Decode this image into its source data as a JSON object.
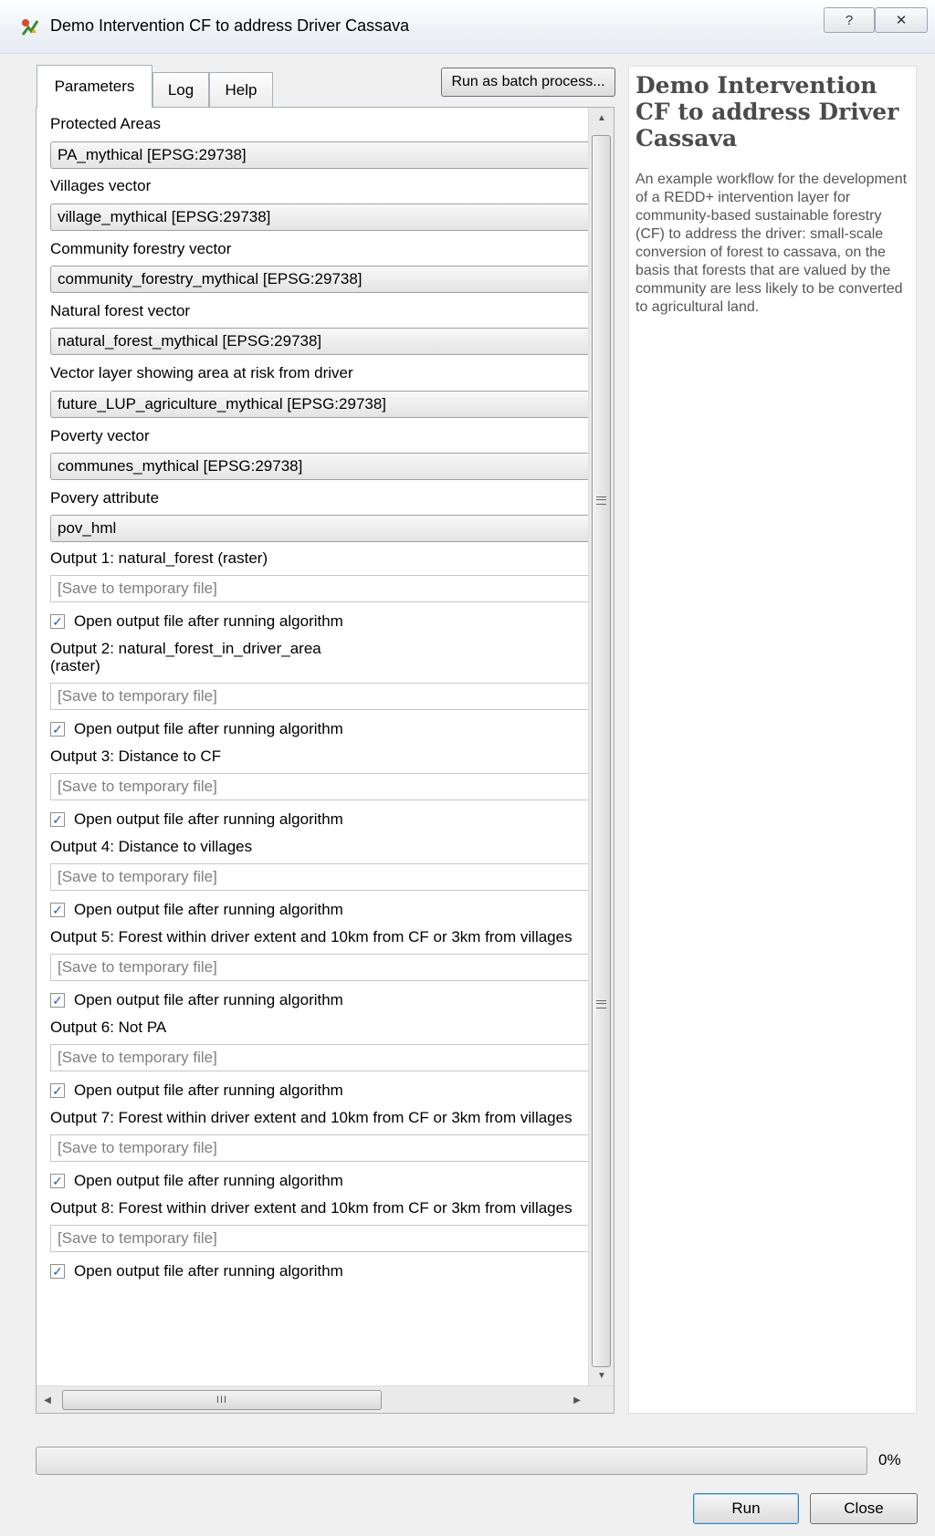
{
  "window": {
    "title": "Demo Intervention CF to address Driver Cassava",
    "help_btn": "?",
    "close_btn": "✕"
  },
  "tabs": [
    "Parameters",
    "Log",
    "Help"
  ],
  "batch_button": "Run as batch process...",
  "params": {
    "protected_areas": {
      "label": "Protected Areas",
      "value": "PA_mythical [EPSG:29738]"
    },
    "villages": {
      "label": "Villages vector",
      "value": "village_mythical [EPSG:29738]"
    },
    "community_forestry": {
      "label": "Community forestry vector",
      "value": "community_forestry_mythical [EPSG:29738]"
    },
    "natural_forest": {
      "label": "Natural forest vector",
      "value": "natural_forest_mythical [EPSG:29738]"
    },
    "risk_area": {
      "label": "Vector layer showing area at risk from driver",
      "value": "future_LUP_agriculture_mythical [EPSG:29738]"
    },
    "poverty_vector": {
      "label": "Poverty vector",
      "value": "communes_mythical [EPSG:29738]"
    },
    "poverty_attribute": {
      "label": "Povery attribute",
      "value": "pov_hml"
    }
  },
  "outputs": [
    {
      "label": "Output 1: natural_forest (raster)",
      "placeholder": "[Save to temporary file]",
      "open_label": "Open output file after running algorithm",
      "checked": true
    },
    {
      "label": "Output 2: natural_forest_in_driver_area",
      "label2": "(raster)",
      "placeholder": "[Save to temporary file]",
      "open_label": "Open output file after running algorithm",
      "checked": true
    },
    {
      "label": "Output 3: Distance to CF",
      "placeholder": "[Save to temporary file]",
      "open_label": "Open output file after running algorithm",
      "checked": true
    },
    {
      "label": "Output 4: Distance to villages",
      "placeholder": "[Save to temporary file]",
      "open_label": "Open output file after running algorithm",
      "checked": true
    },
    {
      "label": "Output 5: Forest within driver extent and 10km from CF or 3km from villages",
      "placeholder": "[Save to temporary file]",
      "open_label": "Open output file after running algorithm",
      "checked": true
    },
    {
      "label": "Output 6: Not PA",
      "placeholder": "[Save to temporary file]",
      "open_label": "Open output file after running algorithm",
      "checked": true
    },
    {
      "label": "Output 7: Forest within driver extent and 10km from CF or 3km from villages",
      "placeholder": "[Save to temporary file]",
      "open_label": "Open output file after running algorithm",
      "checked": true
    },
    {
      "label": "Output 8: Forest within driver extent and 10km from CF or 3km from villages",
      "placeholder": "[Save to temporary file]",
      "open_label": "Open output file after running algorithm",
      "checked": true
    }
  ],
  "help": {
    "title": "Demo Intervention CF to address Driver Cassava",
    "description": "An example workflow for the development of a REDD+ intervention layer for community-based sustainable forestry (CF) to address the driver: small-scale conversion of forest to cassava, on the basis that forests that are valued by the community are less likely to be converted to agricultural land."
  },
  "progress": {
    "value": 0,
    "label": "0%"
  },
  "buttons": {
    "run": "Run",
    "close": "Close"
  },
  "scrollbar": {
    "hthumb_glyph": "III"
  },
  "colors": {
    "progress": "#06b025",
    "help_title": "#4b4b4b",
    "placeholder": "#808080"
  }
}
